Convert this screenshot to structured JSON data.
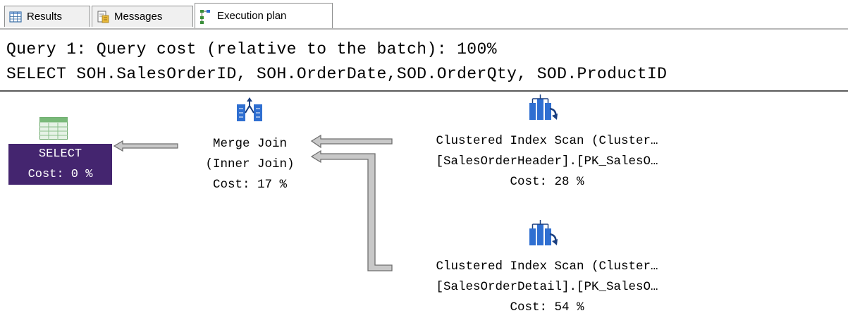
{
  "tabs": [
    {
      "label": "Results",
      "icon": "grid-icon",
      "active": false
    },
    {
      "label": "Messages",
      "icon": "messages-icon",
      "active": false
    },
    {
      "label": "Execution plan",
      "icon": "execution-plan-icon",
      "active": true
    }
  ],
  "query": {
    "header": "Query 1: Query cost (relative to the batch): 100%",
    "text": "SELECT SOH.SalesOrderID, SOH.OrderDate,SOD.OrderQty, SOD.ProductID"
  },
  "plan": {
    "select": {
      "name": "SELECT",
      "cost": "Cost: 0 %"
    },
    "merge_join": {
      "name": "Merge Join",
      "detail": "(Inner Join)",
      "cost": "Cost: 17 %"
    },
    "scan_header": {
      "name": "Clustered Index Scan (Cluster…",
      "object": "[SalesOrderHeader].[PK_SalesO…",
      "cost": "Cost: 28 %"
    },
    "scan_detail": {
      "name": "Clustered Index Scan (Cluster…",
      "object": "[SalesOrderDetail].[PK_SalesO…",
      "cost": "Cost: 54 %"
    }
  },
  "colors": {
    "select_bg": "#44256f",
    "arrow_fill": "#c8c8c8",
    "arrow_stroke": "#6f6f6f",
    "icon_blue": "#2f6fd1"
  }
}
